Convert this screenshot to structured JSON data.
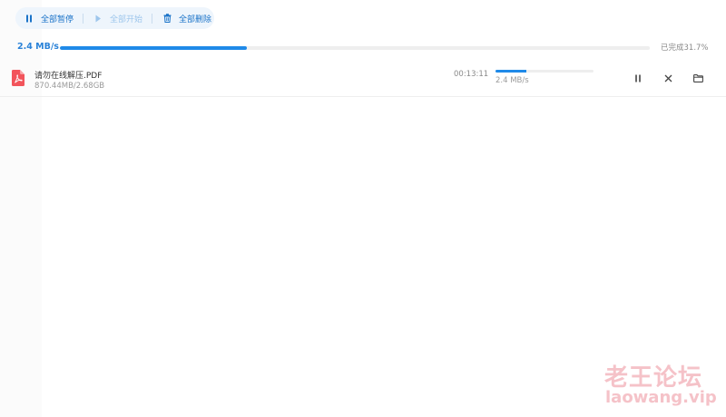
{
  "toolbar": {
    "pause_all": "全部暂停",
    "start_all": "全部开始",
    "delete_all": "全部删除"
  },
  "overall": {
    "speed": "2.4 MB/s",
    "status": "已完成31.7%",
    "progress_fraction": 0.317
  },
  "downloads": [
    {
      "file_name": "请勿在线解压.PDF",
      "size_progress": "870.44MB/2.68GB",
      "time_remaining": "00:13:11",
      "speed": "2.4 MB/s",
      "progress_fraction": 0.317,
      "file_type_icon": "pdf-icon"
    }
  ],
  "colors": {
    "accent": "#1f8ae8",
    "toolbar_bg": "#eef5fc",
    "pdf_red": "#f2545b",
    "watermark": "#f5c2c8"
  },
  "watermark": {
    "line1": "老王论坛",
    "line2": "laowang.vip"
  }
}
